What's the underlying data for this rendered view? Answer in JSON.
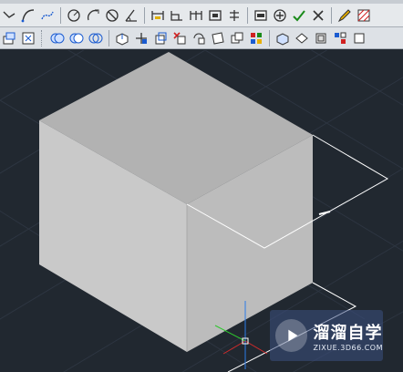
{
  "toolbar_top": {
    "icons": [
      "polyline-icon",
      "arc-icon",
      "spline-icon",
      "circle-icon",
      "arc-tangent-icon",
      "no-entry-icon",
      "angle-icon",
      "dim-linear-icon",
      "dim-aligned-icon",
      "dim-baseline-icon",
      "dim-continue-icon",
      "dim-ordinate-icon",
      "block-icon",
      "add-icon",
      "check-icon",
      "cross-icon",
      "pencil-icon",
      "hatch-icon"
    ]
  },
  "toolbar_bottom": {
    "icons": [
      "ucs-icon",
      "ucs-named-icon",
      "union-icon",
      "subtract-icon",
      "intersect-icon",
      "extrude-face-icon",
      "move-face-icon",
      "offset-face-icon",
      "delete-face-icon",
      "rotate-face-icon",
      "taper-face-icon",
      "copy-face-icon",
      "color-face-icon",
      "imprint-icon",
      "separate-icon",
      "shell-icon",
      "check-solid-icon",
      "extra-icon"
    ]
  },
  "viewport": {
    "background": "#212830",
    "solid_colors": {
      "top": "#b3b3b3",
      "left": "#c9c9c9",
      "right": "#bcbcbc"
    }
  },
  "watermark": {
    "title": "溜溜自学",
    "subtitle": "ZIXUE.3D66.COM"
  }
}
